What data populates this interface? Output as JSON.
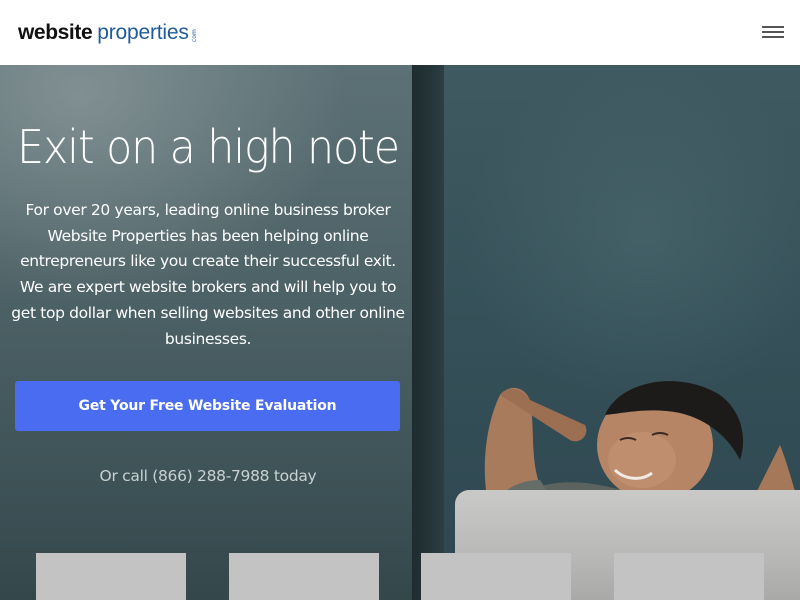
{
  "header": {
    "logo_bold": "website",
    "logo_light": "properties",
    "logo_mark": "com",
    "menu_icon": "hamburger-menu-icon"
  },
  "hero": {
    "title": "Exit on a high note",
    "description": "For over 20 years, leading online business broker Website Properties has been helping online entrepreneurs like you create their successful exit. We are expert website brokers and will help you to get top dollar when selling websites and other online businesses.",
    "cta_label": "Get Your Free Website Evaluation",
    "call_text": "Or call (866) 288-7988 today"
  },
  "colors": {
    "brand_blue": "#1f5b9a",
    "cta_blue": "#4a6cf1",
    "hero_bg": "#4e6367",
    "tile_grey": "#c3c3c3"
  }
}
